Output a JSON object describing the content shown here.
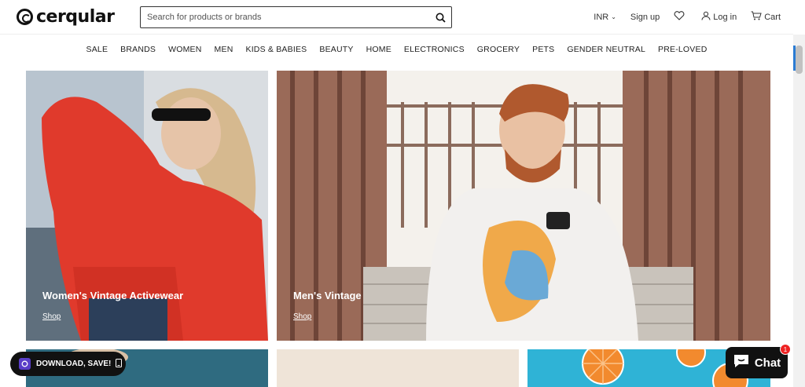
{
  "header": {
    "logo_text": "cerqular",
    "search_placeholder": "Search for products or brands",
    "currency": "INR",
    "signup": "Sign up",
    "login": "Log in",
    "cart": "Cart"
  },
  "nav": {
    "items": [
      "SALE",
      "BRANDS",
      "WOMEN",
      "MEN",
      "KIDS & BABIES",
      "BEAUTY",
      "HOME",
      "ELECTRONICS",
      "GROCERY",
      "PETS",
      "GENDER NEUTRAL",
      "PRE-LOVED"
    ]
  },
  "tiles": {
    "women": {
      "title": "Women's Vintage Activewear",
      "link": "Shop"
    },
    "men": {
      "title": "Men's Vintage",
      "link": "Shop"
    }
  },
  "widgets": {
    "download_label": "DOWNLOAD, SAVE!",
    "chat_label": "Chat",
    "chat_badge": "1"
  },
  "colors": {
    "accent": "#2b7cd3",
    "chat_badge": "#ee2222"
  }
}
